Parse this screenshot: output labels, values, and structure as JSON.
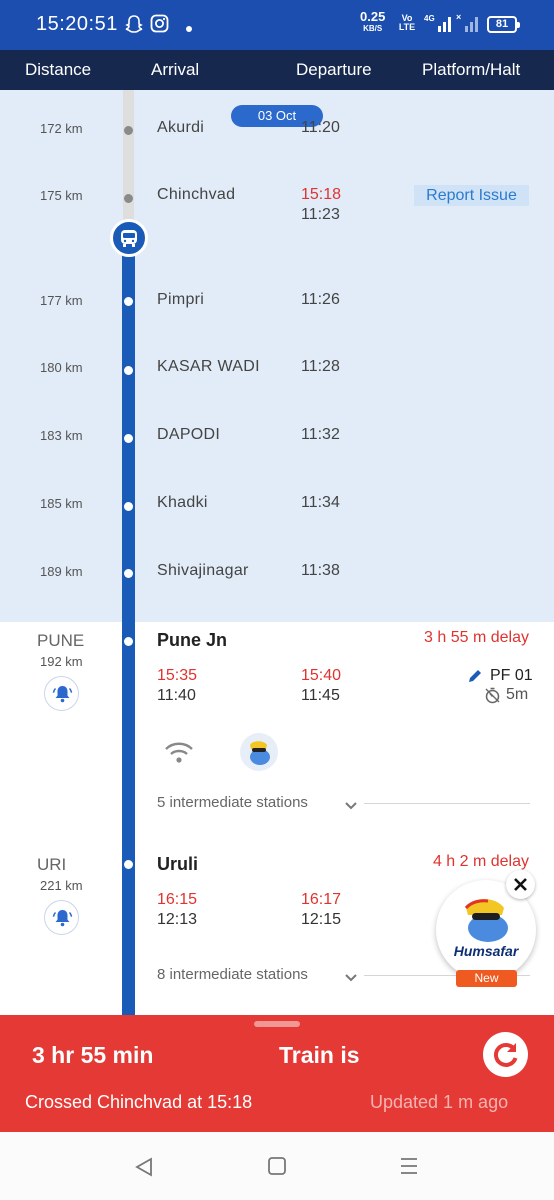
{
  "status_bar": {
    "time": "15:20:51",
    "net_speed": "0.25",
    "net_speed_unit": "KB/S",
    "volte": "Vo LTE",
    "network": "4G",
    "battery": "81"
  },
  "columns": {
    "distance": "Distance",
    "arrival": "Arrival",
    "departure": "Departure",
    "platform": "Platform/Halt"
  },
  "date_badge": "03 Oct",
  "past_stations": [
    {
      "km": "172 km",
      "name": "Akurdi",
      "actual": "",
      "time": "11:20"
    },
    {
      "km": "175 km",
      "name": "Chinchvad",
      "actual": "15:18",
      "time": "11:23"
    },
    {
      "km": "177 km",
      "name": "Pimpri",
      "time": "11:26"
    },
    {
      "km": "180 km",
      "name": "KASAR WADI",
      "time": "11:28"
    },
    {
      "km": "183 km",
      "name": "DAPODI",
      "time": "11:32"
    },
    {
      "km": "185 km",
      "name": "Khadki",
      "time": "11:34"
    },
    {
      "km": "189 km",
      "name": "Shivajinagar",
      "time": "11:38"
    }
  ],
  "report_issue": "Report Issue",
  "major_stations": [
    {
      "code": "PUNE",
      "km": "192 km",
      "name": "Pune Jn",
      "delay": "3 h 55 m delay",
      "arr_actual": "15:35",
      "arr_sched": "11:40",
      "dep_actual": "15:40",
      "dep_sched": "11:45",
      "platform": "PF 01",
      "halt": "5m",
      "intermediate": "5 intermediate stations"
    },
    {
      "code": "URI",
      "km": "221 km",
      "name": "Uruli",
      "delay": "4 h 2 m delay",
      "arr_actual": "16:15",
      "arr_sched": "12:13",
      "dep_actual": "16:17",
      "dep_sched": "12:15",
      "intermediate": "8 intermediate stations"
    }
  ],
  "humsafar": {
    "label": "Humsafar",
    "badge": "New"
  },
  "bottom_panel": {
    "delay": "3 hr 55 min",
    "status": "Train is",
    "crossed": "Crossed Chinchvad at 15:18",
    "updated": "Updated 1 m ago"
  },
  "colors": {
    "status_bar": "#1b4eae",
    "header": "#16284e",
    "track": "#1b5bb8",
    "delay_red": "#e0332f",
    "panel_red": "#e53935"
  }
}
